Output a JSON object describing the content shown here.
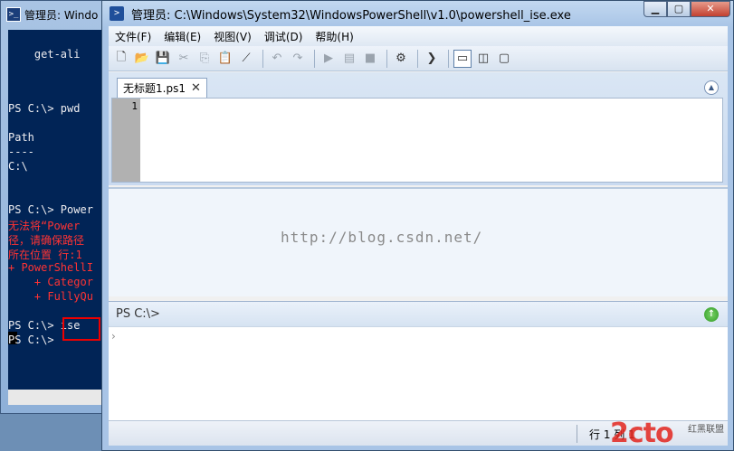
{
  "console": {
    "title": "管理员: Windo",
    "icon": "powershell-icon",
    "lines": [
      {
        "text": "    get-ali",
        "err": false
      },
      {
        "text": "PS C:\\> pwd",
        "err": false
      },
      {
        "text": "Path",
        "err": false
      },
      {
        "text": "----",
        "err": false
      },
      {
        "text": "C:\\",
        "err": false
      },
      {
        "text": "PS C:\\> Power",
        "err": false
      },
      {
        "text": "无法将“Power",
        "err": true
      },
      {
        "text": "径，请确保路径",
        "err": true
      },
      {
        "text": "所在位置 行:1",
        "err": true
      },
      {
        "text": "+ PowerShellI",
        "err": true
      },
      {
        "text": "    + Categor",
        "err": true
      },
      {
        "text": "    + FullyQu",
        "err": true
      },
      {
        "text": "PS C:\\> ise",
        "err": false
      },
      {
        "text": "PS C:\\>",
        "err": false
      }
    ]
  },
  "ise": {
    "title": "管理员: C:\\Windows\\System32\\WindowsPowerShell\\v1.0\\powershell_ise.exe",
    "window_buttons": {
      "minimize": "▁",
      "maximize": "▢",
      "close": "✕"
    },
    "menu": [
      "文件(F)",
      "编辑(E)",
      "视图(V)",
      "调试(D)",
      "帮助(H)"
    ],
    "toolbar": [
      {
        "name": "new-file-icon",
        "glyph": "🗋",
        "dim": false
      },
      {
        "name": "open-folder-icon",
        "glyph": "📂",
        "dim": false
      },
      {
        "name": "save-icon",
        "glyph": "💾",
        "dim": false
      },
      {
        "name": "cut-icon",
        "glyph": "✂",
        "dim": true
      },
      {
        "name": "copy-icon",
        "glyph": "⎘",
        "dim": true
      },
      {
        "name": "paste-icon",
        "glyph": "📋",
        "dim": false
      },
      {
        "name": "clear-icon",
        "glyph": "⟋",
        "dim": false
      },
      {
        "name": "sep",
        "glyph": "",
        "dim": false
      },
      {
        "name": "undo-icon",
        "glyph": "↶",
        "dim": true
      },
      {
        "name": "redo-icon",
        "glyph": "↷",
        "dim": true
      },
      {
        "name": "sep",
        "glyph": "",
        "dim": false
      },
      {
        "name": "run-icon",
        "glyph": "▶",
        "dim": true
      },
      {
        "name": "run-selection-icon",
        "glyph": "▤",
        "dim": true
      },
      {
        "name": "stop-icon",
        "glyph": "■",
        "dim": true
      },
      {
        "name": "sep",
        "glyph": "",
        "dim": false
      },
      {
        "name": "remote-icon",
        "glyph": "⚙",
        "dim": false
      },
      {
        "name": "sep",
        "glyph": "",
        "dim": false
      },
      {
        "name": "powershell-icon",
        "glyph": "❯",
        "dim": false
      },
      {
        "name": "sep",
        "glyph": "",
        "dim": false
      },
      {
        "name": "layout-top-icon",
        "glyph": "▭",
        "dim": false,
        "sel": true
      },
      {
        "name": "layout-right-icon",
        "glyph": "◫",
        "dim": false
      },
      {
        "name": "layout-max-icon",
        "glyph": "▢",
        "dim": false
      }
    ],
    "tab": {
      "label": "无标题1.ps1",
      "close": "✕"
    },
    "collapse": "▲",
    "line_number": "1",
    "watermark": "http://blog.csdn.net/",
    "prompt": "PS C:\\>",
    "run_button": "↑",
    "caret": "›",
    "status": "行 1 列 1",
    "logo": "2cto",
    "logo_sub": "红黑联盟"
  }
}
